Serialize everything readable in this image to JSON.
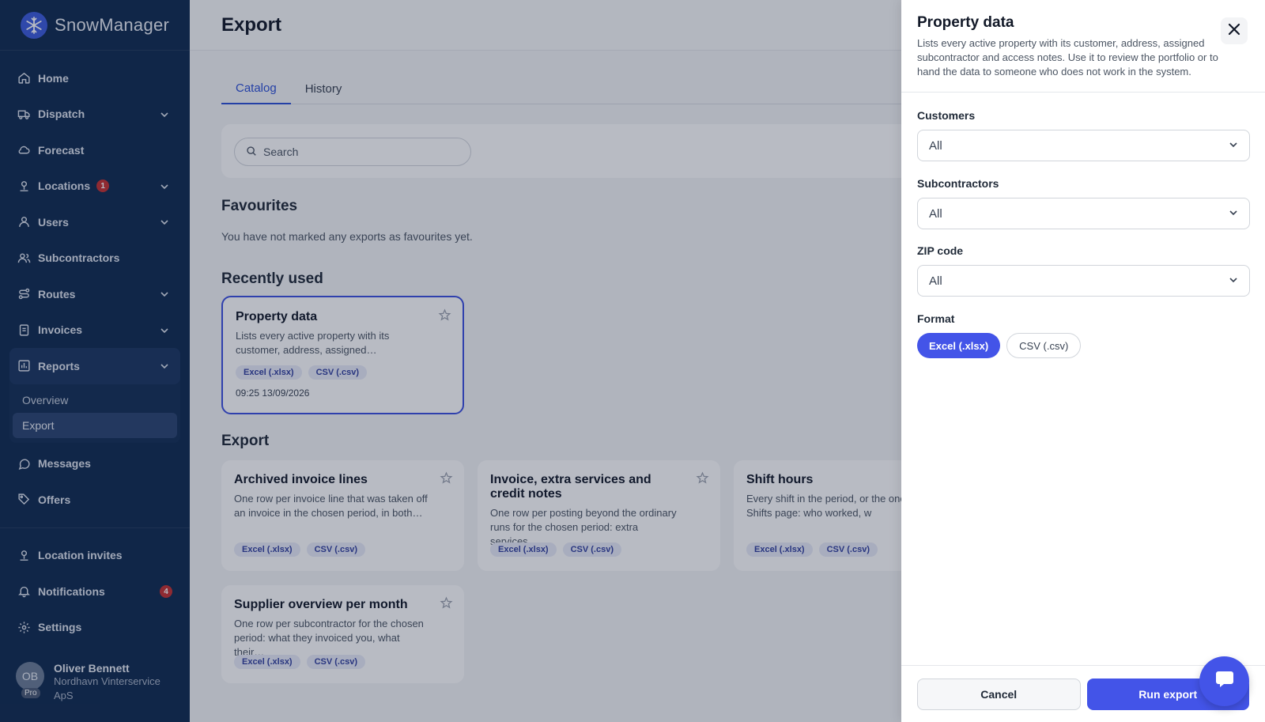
{
  "app": {
    "name": "SnowManager"
  },
  "sidebar": {
    "items": [
      {
        "label": "Home",
        "icon": "home-icon"
      },
      {
        "label": "Dispatch",
        "icon": "truck-icon"
      },
      {
        "label": "Forecast",
        "icon": "cloud-icon"
      },
      {
        "label": "Locations",
        "icon": "location-icon",
        "badge": "1"
      },
      {
        "label": "Users",
        "icon": "user-icon"
      },
      {
        "label": "Subcontractors",
        "icon": "users-icon"
      },
      {
        "label": "Routes",
        "icon": "route-icon"
      },
      {
        "label": "Invoices",
        "icon": "invoice-icon"
      },
      {
        "label": "Reports",
        "icon": "chart-icon"
      }
    ],
    "reports_sub": [
      {
        "label": "Overview"
      },
      {
        "label": "Export"
      }
    ],
    "items_after": [
      {
        "label": "Messages",
        "icon": "message-icon"
      },
      {
        "label": "Offers",
        "icon": "tag-icon"
      }
    ],
    "bottom_items": [
      {
        "label": "Location invites",
        "icon": "location-invite-icon"
      },
      {
        "label": "Notifications",
        "icon": "bell-icon",
        "badge": "4"
      },
      {
        "label": "Settings",
        "icon": "gear-icon"
      }
    ],
    "user": {
      "initials": "OB",
      "plan": "Pro",
      "name": "Oliver Bennett",
      "org": "Nordhavn Vinterservice ApS"
    }
  },
  "page": {
    "title": "Export",
    "tabs": [
      {
        "label": "Catalog"
      },
      {
        "label": "History"
      }
    ],
    "search_placeholder": "Search",
    "favourites": {
      "title": "Favourites",
      "empty": "You have not marked any exports as favourites yet."
    },
    "recent": {
      "title": "Recently used",
      "cards": [
        {
          "title": "Property data",
          "desc": "Lists every active property with its customer, address, assigned…",
          "formats": [
            "Excel (.xlsx)",
            "CSV (.csv)"
          ],
          "time": "09:25 13/09/2026"
        }
      ]
    },
    "export": {
      "title": "Export",
      "cards": [
        {
          "title": "Archived invoice lines",
          "desc": "One row per invoice line that was taken off an invoice in the chosen period, in both…",
          "formats": [
            "Excel (.xlsx)",
            "CSV (.csv)"
          ]
        },
        {
          "title": "Invoice, extra services and credit notes",
          "desc": "One row per posting beyond the ordinary runs for the chosen period: extra services,…",
          "formats": [
            "Excel (.xlsx)",
            "CSV (.csv)"
          ]
        },
        {
          "title": "Shift hours",
          "desc": "Every shift in the period, or the one on the Shifts page: who worked, w",
          "formats": [
            "Excel (.xlsx)",
            "CSV (.csv)"
          ]
        },
        {
          "title": "Supplier overview per month",
          "desc": "One row per subcontractor for the chosen period: what they invoiced you, what their…",
          "formats": [
            "Excel (.xlsx)",
            "CSV (.csv)"
          ]
        }
      ]
    }
  },
  "drawer": {
    "title": "Property data",
    "desc": "Lists every active property with its customer, address, assigned subcontractor and access notes. Use it to review the portfolio or to hand the data to someone who does not work in the system.",
    "fields": [
      {
        "label": "Customers",
        "value": "All"
      },
      {
        "label": "Subcontractors",
        "value": "All"
      },
      {
        "label": "ZIP code",
        "value": "All"
      }
    ],
    "format": {
      "label": "Format",
      "options": [
        "Excel (.xlsx)",
        "CSV (.csv)"
      ],
      "selected": "Excel (.xlsx)"
    },
    "cancel": "Cancel",
    "run": "Run export"
  },
  "colors": {
    "sidebar": "#0f2a4f",
    "accent": "#4354e8",
    "badge": "#c53030"
  }
}
